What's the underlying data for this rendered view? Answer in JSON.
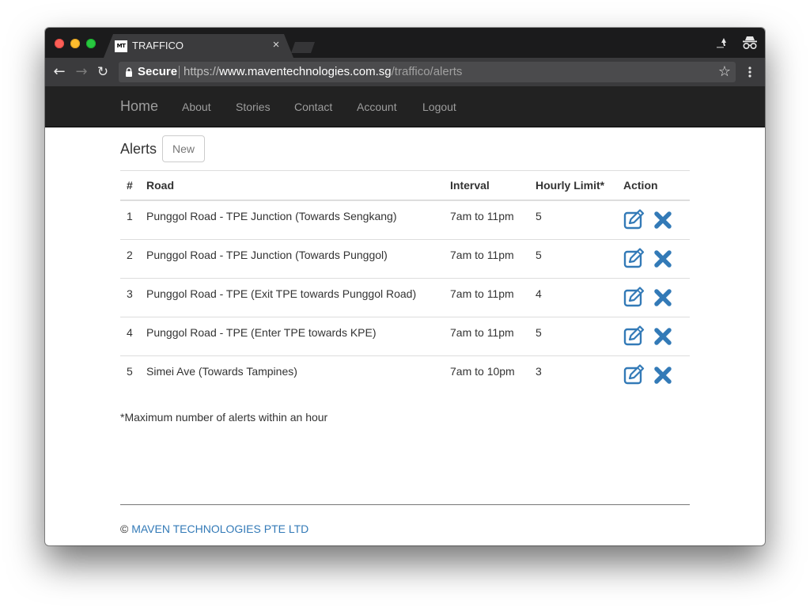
{
  "browser": {
    "tab_title": "TRAFFICO",
    "favicon_text": "MT",
    "tab_close": "×",
    "secure_label": "Secure",
    "url_scheme": "https://",
    "url_host": "www.maventechnologies.com.sg",
    "url_path": "/traffico/alerts",
    "back_icon": "←",
    "forward_icon": "→",
    "reload_icon": "↻",
    "star_icon": "☆"
  },
  "navbar": {
    "brand": "Home",
    "links": [
      "About",
      "Stories",
      "Contact",
      "Account",
      "Logout"
    ]
  },
  "page": {
    "title": "Alerts",
    "new_button": "New"
  },
  "table": {
    "headers": {
      "num": "#",
      "road": "Road",
      "interval": "Interval",
      "limit": "Hourly Limit*",
      "action": "Action"
    },
    "rows": [
      {
        "num": "1",
        "road": "Punggol Road - TPE Junction (Towards Sengkang)",
        "interval": "7am to 11pm",
        "limit": "5"
      },
      {
        "num": "2",
        "road": "Punggol Road - TPE Junction (Towards Punggol)",
        "interval": "7am to 11pm",
        "limit": "5"
      },
      {
        "num": "3",
        "road": "Punggol Road - TPE (Exit TPE towards Punggol Road)",
        "interval": "7am to 11pm",
        "limit": "4"
      },
      {
        "num": "4",
        "road": "Punggol Road - TPE (Enter TPE towards KPE)",
        "interval": "7am to 11pm",
        "limit": "5"
      },
      {
        "num": "5",
        "road": "Simei Ave (Towards Tampines)",
        "interval": "7am to 10pm",
        "limit": "3"
      }
    ]
  },
  "footnote": "*Maximum number of alerts within an hour",
  "footer": {
    "copyright": "©",
    "company": "MAVEN TECHNOLOGIES PTE LTD"
  },
  "colors": {
    "action_blue": "#337ab7",
    "navbar_bg": "#222222",
    "navbar_text": "#9d9d9d"
  }
}
